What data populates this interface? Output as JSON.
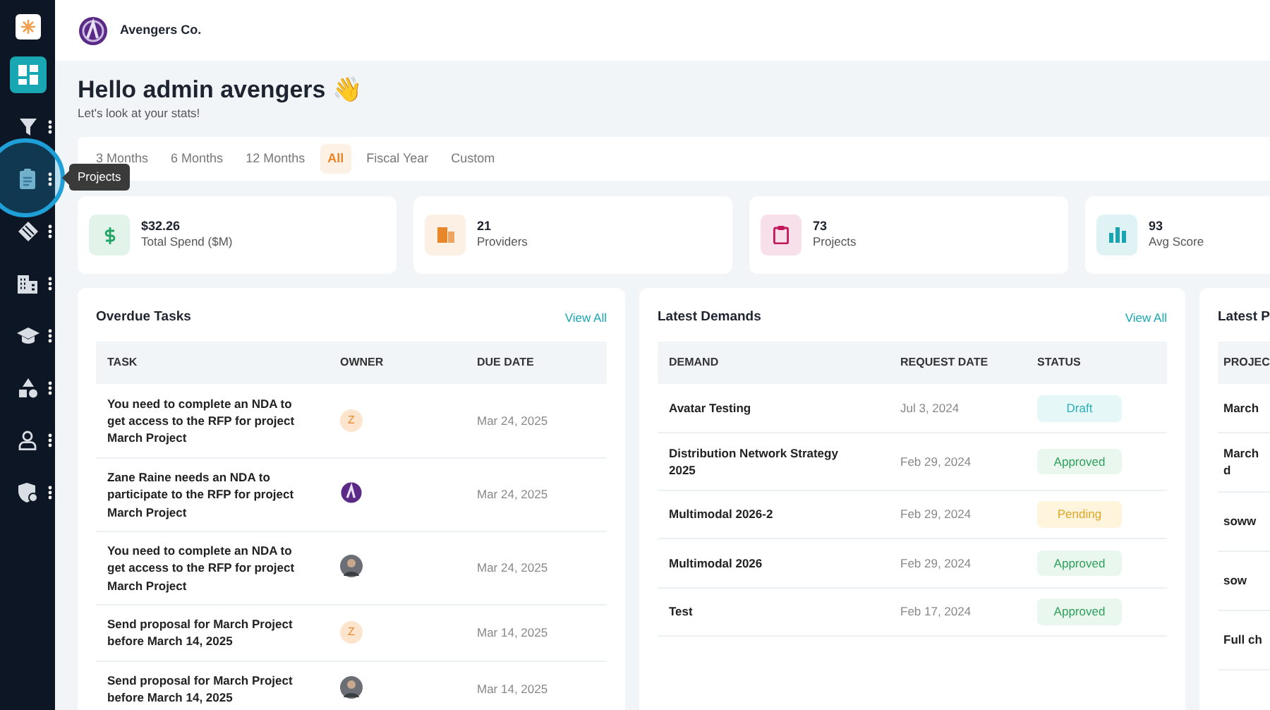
{
  "sidebar": {
    "items": [
      {
        "selected": true,
        "menu": false,
        "highlighted": false
      },
      {
        "selected": false,
        "menu": true,
        "highlighted": false
      },
      {
        "selected": false,
        "menu": true,
        "highlighted": true
      },
      {
        "selected": false,
        "menu": true,
        "highlighted": false
      },
      {
        "selected": false,
        "menu": true,
        "highlighted": false
      },
      {
        "selected": false,
        "menu": true,
        "highlighted": false
      },
      {
        "selected": false,
        "menu": true,
        "highlighted": false
      },
      {
        "selected": false,
        "menu": true,
        "highlighted": false
      },
      {
        "selected": false,
        "menu": true,
        "highlighted": false
      }
    ],
    "tooltip": "Projects"
  },
  "header": {
    "company": "Avengers Co."
  },
  "greeting": {
    "title": "Hello admin avengers 👋",
    "subtitle": "Let's look at your stats!"
  },
  "periods": [
    {
      "label": "3 Months",
      "selected": false
    },
    {
      "label": "6 Months",
      "selected": false
    },
    {
      "label": "12 Months",
      "selected": false
    },
    {
      "label": "All",
      "selected": true
    },
    {
      "label": "Fiscal Year",
      "selected": false
    },
    {
      "label": "Custom",
      "selected": false
    }
  ],
  "stats": [
    {
      "value": "$32.26",
      "label": "Total Spend ($M)",
      "color": "#22a565"
    },
    {
      "value": "21",
      "label": "Providers",
      "color": "#e8862a"
    },
    {
      "value": "73",
      "label": "Projects",
      "color": "#c2185b"
    },
    {
      "value": "93",
      "label": "Avg Score",
      "color": "#1aa3b0"
    }
  ],
  "overdue_tasks": {
    "title": "Overdue Tasks",
    "link": "View All",
    "columns": [
      "TASK",
      "OWNER",
      "DUE DATE"
    ],
    "rows": [
      {
        "task": "You need to complete an NDA to get access to the RFP for project March Project",
        "owner": {
          "kind": "initial",
          "text": "Z"
        },
        "due": "Mar 24, 2025"
      },
      {
        "task": "Zane Raine needs an NDA to participate to the RFP for project March Project",
        "owner": {
          "kind": "logo"
        },
        "due": "Mar 24, 2025"
      },
      {
        "task": "You need to complete an NDA to get access to the RFP for project March Project",
        "owner": {
          "kind": "photo"
        },
        "due": "Mar 24, 2025"
      },
      {
        "task": "Send proposal for March Project before March 14, 2025",
        "owner": {
          "kind": "initial",
          "text": "Z"
        },
        "due": "Mar 14, 2025"
      },
      {
        "task": "Send proposal for March Project before March 14, 2025",
        "owner": {
          "kind": "photo"
        },
        "due": "Mar 14, 2025"
      }
    ]
  },
  "latest_demands": {
    "title": "Latest Demands",
    "link": "View All",
    "columns": [
      "DEMAND",
      "REQUEST DATE",
      "STATUS"
    ],
    "rows": [
      {
        "demand": "Avatar Testing",
        "date": "Jul 3, 2024",
        "status": "Draft",
        "kind": "draft"
      },
      {
        "demand": "Distribution Network Strategy 2025",
        "date": "Feb 29, 2024",
        "status": "Approved",
        "kind": "approved"
      },
      {
        "demand": "Multimodal 2026-2",
        "date": "Feb 29, 2024",
        "status": "Pending",
        "kind": "pending"
      },
      {
        "demand": "Multimodal 2026",
        "date": "Feb 29, 2024",
        "status": "Approved",
        "kind": "approved"
      },
      {
        "demand": "Test",
        "date": "Feb 17, 2024",
        "status": "Approved",
        "kind": "approved"
      }
    ]
  },
  "third_panel": {
    "title": "Latest P",
    "column_1": "PROJEC",
    "rows": [
      "March",
      "March\nd",
      "soww",
      "sow",
      "Full ch"
    ]
  }
}
